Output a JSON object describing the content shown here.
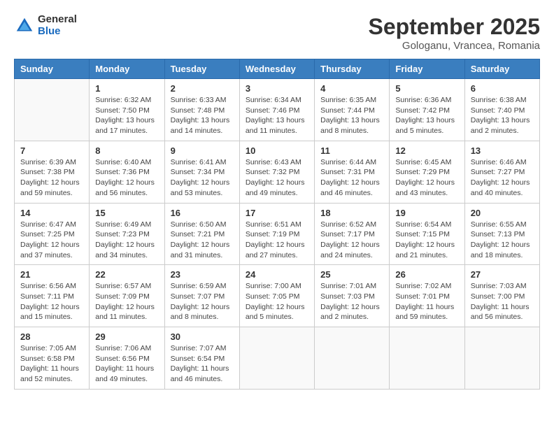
{
  "header": {
    "logo": {
      "general": "General",
      "blue": "Blue"
    },
    "month": "September 2025",
    "location": "Gologanu, Vrancea, Romania"
  },
  "days_of_week": [
    "Sunday",
    "Monday",
    "Tuesday",
    "Wednesday",
    "Thursday",
    "Friday",
    "Saturday"
  ],
  "weeks": [
    [
      {
        "day": "",
        "info": ""
      },
      {
        "day": "1",
        "info": "Sunrise: 6:32 AM\nSunset: 7:50 PM\nDaylight: 13 hours and 17 minutes."
      },
      {
        "day": "2",
        "info": "Sunrise: 6:33 AM\nSunset: 7:48 PM\nDaylight: 13 hours and 14 minutes."
      },
      {
        "day": "3",
        "info": "Sunrise: 6:34 AM\nSunset: 7:46 PM\nDaylight: 13 hours and 11 minutes."
      },
      {
        "day": "4",
        "info": "Sunrise: 6:35 AM\nSunset: 7:44 PM\nDaylight: 13 hours and 8 minutes."
      },
      {
        "day": "5",
        "info": "Sunrise: 6:36 AM\nSunset: 7:42 PM\nDaylight: 13 hours and 5 minutes."
      },
      {
        "day": "6",
        "info": "Sunrise: 6:38 AM\nSunset: 7:40 PM\nDaylight: 13 hours and 2 minutes."
      }
    ],
    [
      {
        "day": "7",
        "info": "Sunrise: 6:39 AM\nSunset: 7:38 PM\nDaylight: 12 hours and 59 minutes."
      },
      {
        "day": "8",
        "info": "Sunrise: 6:40 AM\nSunset: 7:36 PM\nDaylight: 12 hours and 56 minutes."
      },
      {
        "day": "9",
        "info": "Sunrise: 6:41 AM\nSunset: 7:34 PM\nDaylight: 12 hours and 53 minutes."
      },
      {
        "day": "10",
        "info": "Sunrise: 6:43 AM\nSunset: 7:32 PM\nDaylight: 12 hours and 49 minutes."
      },
      {
        "day": "11",
        "info": "Sunrise: 6:44 AM\nSunset: 7:31 PM\nDaylight: 12 hours and 46 minutes."
      },
      {
        "day": "12",
        "info": "Sunrise: 6:45 AM\nSunset: 7:29 PM\nDaylight: 12 hours and 43 minutes."
      },
      {
        "day": "13",
        "info": "Sunrise: 6:46 AM\nSunset: 7:27 PM\nDaylight: 12 hours and 40 minutes."
      }
    ],
    [
      {
        "day": "14",
        "info": "Sunrise: 6:47 AM\nSunset: 7:25 PM\nDaylight: 12 hours and 37 minutes."
      },
      {
        "day": "15",
        "info": "Sunrise: 6:49 AM\nSunset: 7:23 PM\nDaylight: 12 hours and 34 minutes."
      },
      {
        "day": "16",
        "info": "Sunrise: 6:50 AM\nSunset: 7:21 PM\nDaylight: 12 hours and 31 minutes."
      },
      {
        "day": "17",
        "info": "Sunrise: 6:51 AM\nSunset: 7:19 PM\nDaylight: 12 hours and 27 minutes."
      },
      {
        "day": "18",
        "info": "Sunrise: 6:52 AM\nSunset: 7:17 PM\nDaylight: 12 hours and 24 minutes."
      },
      {
        "day": "19",
        "info": "Sunrise: 6:54 AM\nSunset: 7:15 PM\nDaylight: 12 hours and 21 minutes."
      },
      {
        "day": "20",
        "info": "Sunrise: 6:55 AM\nSunset: 7:13 PM\nDaylight: 12 hours and 18 minutes."
      }
    ],
    [
      {
        "day": "21",
        "info": "Sunrise: 6:56 AM\nSunset: 7:11 PM\nDaylight: 12 hours and 15 minutes."
      },
      {
        "day": "22",
        "info": "Sunrise: 6:57 AM\nSunset: 7:09 PM\nDaylight: 12 hours and 11 minutes."
      },
      {
        "day": "23",
        "info": "Sunrise: 6:59 AM\nSunset: 7:07 PM\nDaylight: 12 hours and 8 minutes."
      },
      {
        "day": "24",
        "info": "Sunrise: 7:00 AM\nSunset: 7:05 PM\nDaylight: 12 hours and 5 minutes."
      },
      {
        "day": "25",
        "info": "Sunrise: 7:01 AM\nSunset: 7:03 PM\nDaylight: 12 hours and 2 minutes."
      },
      {
        "day": "26",
        "info": "Sunrise: 7:02 AM\nSunset: 7:01 PM\nDaylight: 11 hours and 59 minutes."
      },
      {
        "day": "27",
        "info": "Sunrise: 7:03 AM\nSunset: 7:00 PM\nDaylight: 11 hours and 56 minutes."
      }
    ],
    [
      {
        "day": "28",
        "info": "Sunrise: 7:05 AM\nSunset: 6:58 PM\nDaylight: 11 hours and 52 minutes."
      },
      {
        "day": "29",
        "info": "Sunrise: 7:06 AM\nSunset: 6:56 PM\nDaylight: 11 hours and 49 minutes."
      },
      {
        "day": "30",
        "info": "Sunrise: 7:07 AM\nSunset: 6:54 PM\nDaylight: 11 hours and 46 minutes."
      },
      {
        "day": "",
        "info": ""
      },
      {
        "day": "",
        "info": ""
      },
      {
        "day": "",
        "info": ""
      },
      {
        "day": "",
        "info": ""
      }
    ]
  ]
}
